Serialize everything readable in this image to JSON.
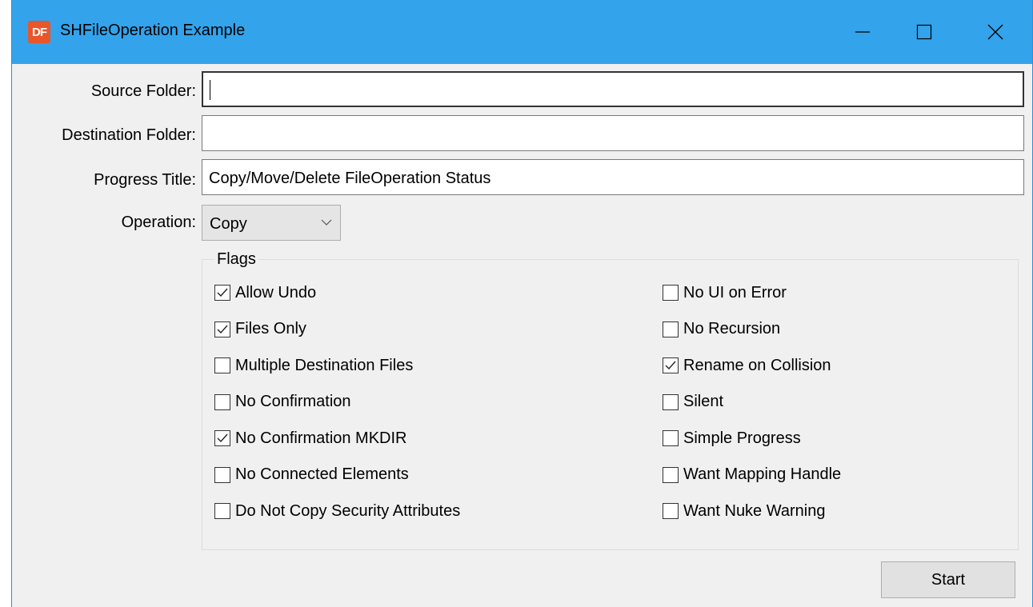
{
  "window": {
    "title": "SHFileOperation Example",
    "icon_text": "DF",
    "accent_color": "#33a3ec",
    "icon_color": "#e8562a"
  },
  "fields": {
    "source_label": "Source Folder:",
    "source_value": "",
    "destination_label": "Destination Folder:",
    "destination_value": "",
    "progress_title_label": "Progress Title:",
    "progress_title_value": "Copy/Move/Delete FileOperation Status",
    "operation_label": "Operation:",
    "operation_value": "Copy"
  },
  "flags": {
    "title": "Flags",
    "left": [
      {
        "label": "Allow Undo",
        "checked": true
      },
      {
        "label": "Files Only",
        "checked": true
      },
      {
        "label": "Multiple Destination Files",
        "checked": false
      },
      {
        "label": "No Confirmation",
        "checked": false
      },
      {
        "label": "No Confirmation MKDIR",
        "checked": true
      },
      {
        "label": "No Connected Elements",
        "checked": false
      },
      {
        "label": "Do Not Copy Security Attributes",
        "checked": false
      }
    ],
    "right": [
      {
        "label": "No UI on Error",
        "checked": false
      },
      {
        "label": "No Recursion",
        "checked": false
      },
      {
        "label": "Rename on Collision",
        "checked": true
      },
      {
        "label": "Silent",
        "checked": false
      },
      {
        "label": "Simple Progress",
        "checked": false
      },
      {
        "label": "Want Mapping Handle",
        "checked": false
      },
      {
        "label": "Want Nuke Warning",
        "checked": false
      }
    ]
  },
  "actions": {
    "start_label": "Start"
  },
  "icons": {
    "minimize": "minimize-icon",
    "maximize": "maximize-icon",
    "close": "close-icon",
    "dropdown": "chevron-down-icon",
    "check": "checkmark-icon"
  }
}
